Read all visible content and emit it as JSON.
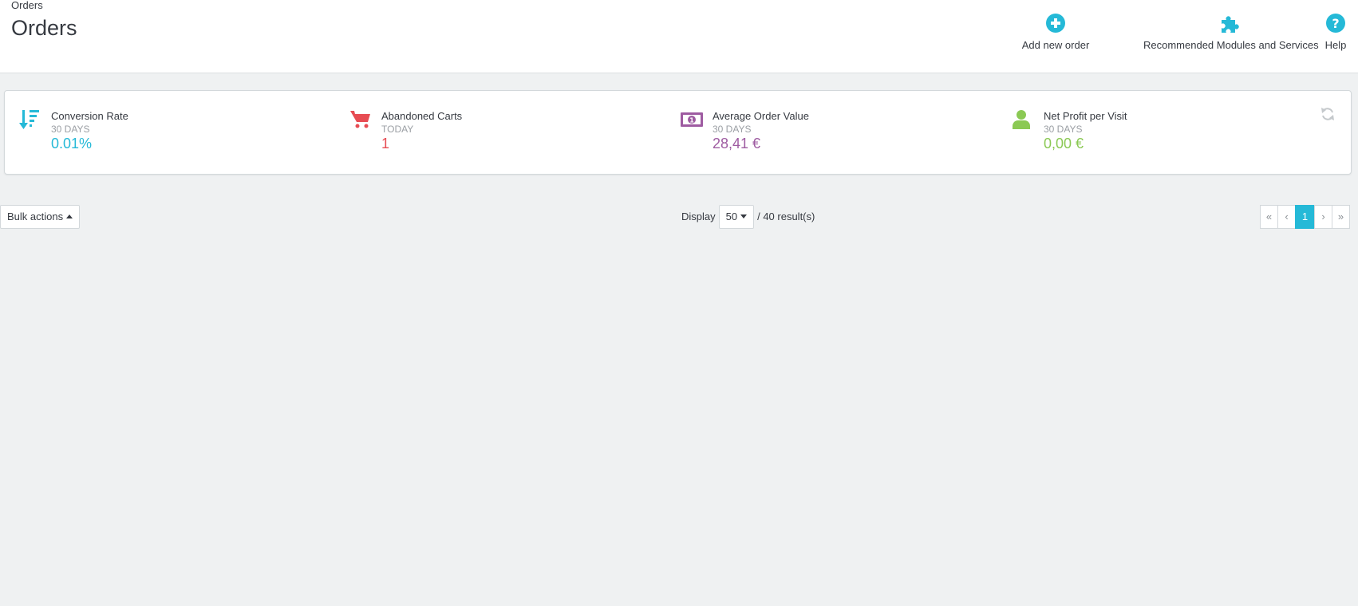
{
  "header": {
    "breadcrumb": "Orders",
    "title": "Orders",
    "toolbar": [
      {
        "label": "Add new order",
        "icon": "plus-circle-icon"
      },
      {
        "label": "Recommended Modules and Services",
        "icon": "puzzle-icon"
      },
      {
        "label": "Help",
        "icon": "question-circle-icon"
      }
    ]
  },
  "kpis": [
    {
      "title": "Conversion Rate",
      "period": "30 DAYS",
      "value": "0.01%",
      "color": "#25b9d7",
      "icon": "sort-amount-down-icon"
    },
    {
      "title": "Abandoned Carts",
      "period": "TODAY",
      "value": "1",
      "color": "#e74c53",
      "icon": "shopping-cart-icon"
    },
    {
      "title": "Average Order Value",
      "period": "30 DAYS",
      "value": "28,41 €",
      "color": "#9e5ba1",
      "icon": "money-icon"
    },
    {
      "title": "Net Profit per Visit",
      "period": "30 DAYS",
      "value": "0,00 €",
      "color": "#8bc954",
      "icon": "user-icon"
    }
  ],
  "list": {
    "bulk_actions_label": "Bulk actions",
    "display_label": "Display",
    "per_page": "50",
    "results_text": "/ 40 result(s)",
    "current_page": "1"
  },
  "colors": {
    "toolbar_icon": "#25b9d7",
    "pagination_active": "#25b9d7"
  }
}
